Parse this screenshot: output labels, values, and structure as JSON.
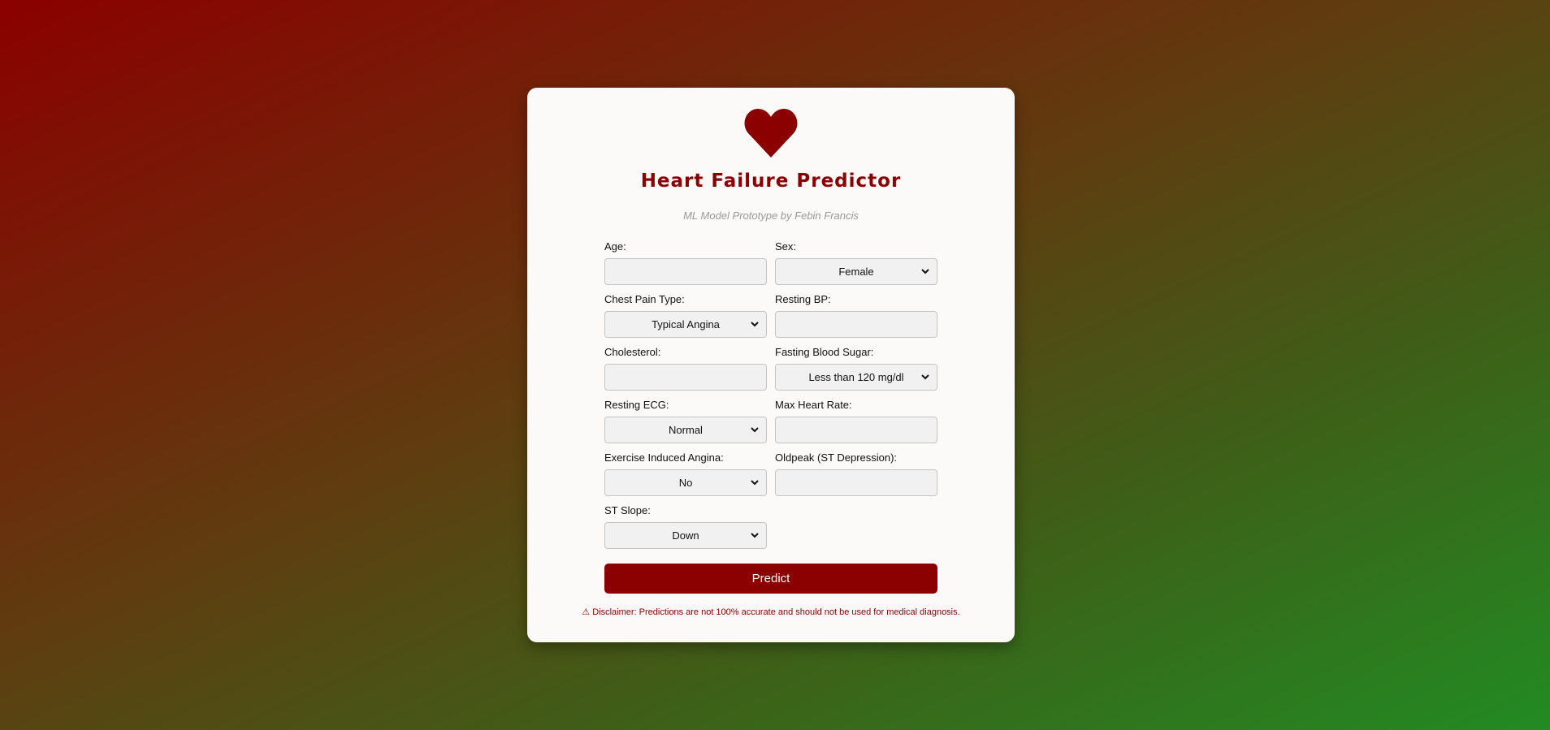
{
  "header": {
    "title": "Heart Failure Predictor",
    "subtitle": "ML Model Prototype by Febin Francis",
    "icon": "heart-icon"
  },
  "form": {
    "age": {
      "label": "Age:",
      "value": ""
    },
    "sex": {
      "label": "Sex:",
      "value": "Female"
    },
    "chest_pain_type": {
      "label": "Chest Pain Type:",
      "value": "Typical Angina"
    },
    "resting_bp": {
      "label": "Resting BP:",
      "value": ""
    },
    "cholesterol": {
      "label": "Cholesterol:",
      "value": ""
    },
    "fasting_blood_sugar": {
      "label": "Fasting Blood Sugar:",
      "value": "Less than 120 mg/dl"
    },
    "resting_ecg": {
      "label": "Resting ECG:",
      "value": "Normal"
    },
    "max_heart_rate": {
      "label": "Max Heart Rate:",
      "value": ""
    },
    "exercise_angina": {
      "label": "Exercise Induced Angina:",
      "value": "No"
    },
    "oldpeak": {
      "label": "Oldpeak (ST Depression):",
      "value": ""
    },
    "st_slope": {
      "label": "ST Slope:",
      "value": "Down"
    }
  },
  "actions": {
    "predict_label": "Predict"
  },
  "disclaimer": "⚠ Disclaimer: Predictions are not 100% accurate and should not be used for medical diagnosis.",
  "colors": {
    "accent": "#8b0000",
    "card": "#fbfaf9",
    "bg_start": "#8b0000",
    "bg_end": "#228b22"
  }
}
